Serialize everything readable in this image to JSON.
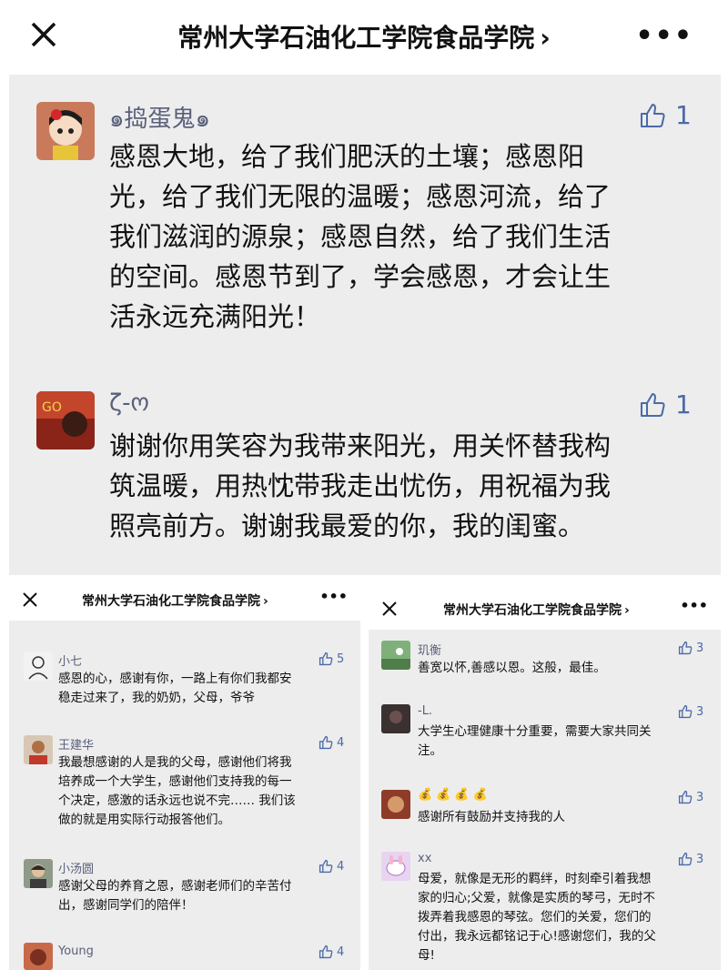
{
  "header": {
    "title": "常州大学石油化工学院食品学院",
    "chevron": "›",
    "more": "•••"
  },
  "main_comments": [
    {
      "user": "๑捣蛋鬼๑",
      "likes": "1",
      "lines": [
        "感恩大地，给了我们肥沃的土壤；感恩阳",
        "光，给了我们无限的温暖；感恩河流，给了",
        "我们滋润的源泉；感恩自然，给了我们生活",
        "的空间。感恩节到了，学会感恩，才会让生",
        "活永远充满阳光！"
      ]
    },
    {
      "user": "ζ-ო",
      "likes": "1",
      "lines": [
        "谢谢你用笑容为我带来阳光，用关怀替我构",
        "筑温暖，用热忱带我走出忧伤，用祝福为我",
        "照亮前方。谢谢我最爱的你，我的闺蜜。"
      ]
    }
  ],
  "left_panel": {
    "title": "常州大学石油化工学院食品学院",
    "comments": [
      {
        "user": "小七",
        "likes": "5",
        "lines": [
          "感恩的心，感谢有你，一路上有你们我都安",
          "稳走过来了，我的奶奶，父母，爷爷"
        ]
      },
      {
        "user": "王建华",
        "likes": "4",
        "lines": [
          "我最想感谢的人是我的父母，感谢他们将我",
          "培养成一个大学生，感谢他们支持我的每一",
          "个决定，感激的话永远也说不完…… 我们该",
          "做的就是用实际行动报答他们。"
        ]
      },
      {
        "user": "小汤圆",
        "likes": "4",
        "lines": [
          "感谢父母的养育之恩，感谢老师们的辛苦付",
          "出，感谢同学们的陪伴！"
        ]
      },
      {
        "user": "Young",
        "likes": "4",
        "lines": []
      }
    ]
  },
  "right_panel": {
    "title": "常州大学石油化工学院食品学院",
    "comments": [
      {
        "user": "玑衡",
        "likes": "3",
        "lines": [
          "善宽以怀,善感以恩。这般，最佳。"
        ]
      },
      {
        "user": "-L.",
        "likes": "3",
        "lines": [
          "大学生心理健康十分重要，需要大家共同关",
          "注。"
        ]
      },
      {
        "user": "💰💰💰💰",
        "likes": "3",
        "lines": [
          "感谢所有鼓励并支持我的人"
        ]
      },
      {
        "user": "xx",
        "likes": "3",
        "lines": [
          "母爱，就像是无形的羁绊，时刻牵引着我想",
          "家的归心;父爱，就像是实质的琴弓，无时不",
          "拨弄着我感恩的琴弦。您们的关爱，您们的",
          "付出，我永远都铭记于心!感谢您们，我的父",
          "母!"
        ]
      }
    ]
  },
  "colors": {
    "accent": "#4a6aa8",
    "username": "#5a5f7a",
    "panel_bg": "#ededed"
  }
}
